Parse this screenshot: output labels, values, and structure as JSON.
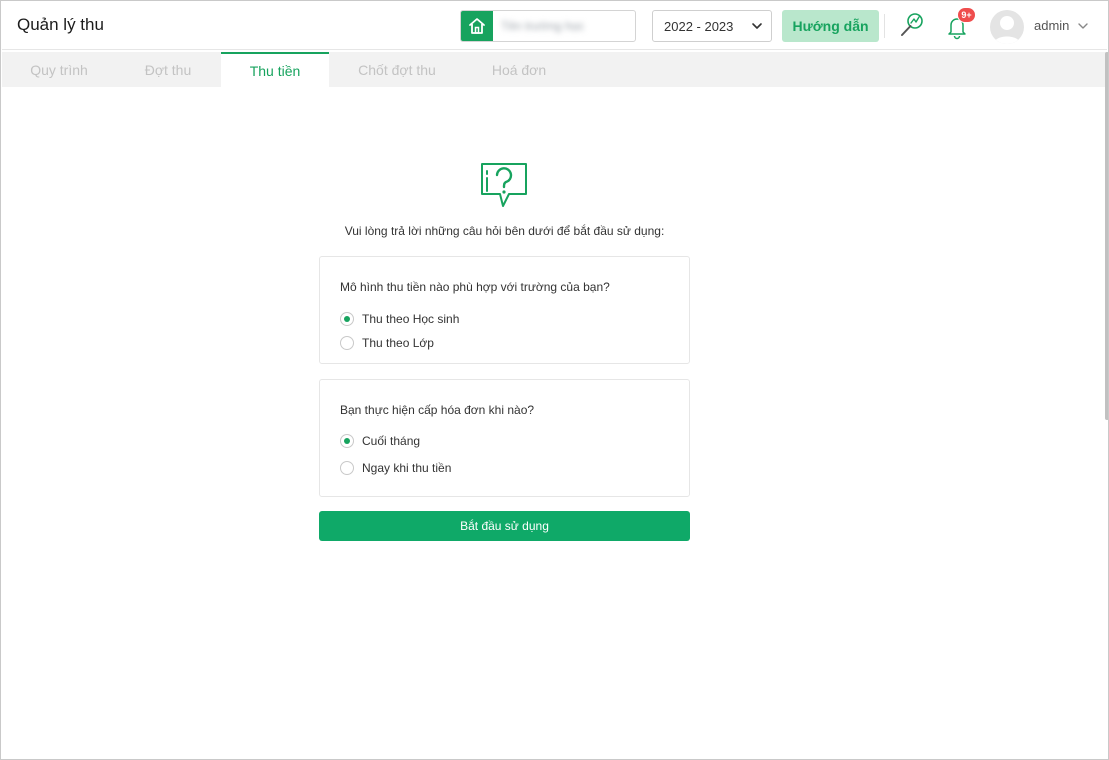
{
  "header": {
    "title": "Quản lý thu",
    "school_name": "Tên trường học",
    "school_year": "2022 - 2023",
    "guide_label": "Hướng dẫn",
    "notification_count": "9+",
    "user_name": "admin"
  },
  "tabs": [
    {
      "label": "Quy trình"
    },
    {
      "label": "Đợt thu"
    },
    {
      "label": "Thu tiền"
    },
    {
      "label": "Chốt đợt thu"
    },
    {
      "label": "Hoá đơn"
    }
  ],
  "active_tab": "Thu tiền",
  "main": {
    "intro": "Vui lòng trả lời những câu hỏi bên dưới để bắt đầu sử dụng:",
    "questions": [
      {
        "question": "Mô hình thu tiền nào phù hợp với trường của bạn?",
        "options": [
          {
            "label": "Thu theo Học sinh",
            "selected": true
          },
          {
            "label": "Thu theo Lớp",
            "selected": false
          }
        ]
      },
      {
        "question": "Bạn thực hiện cấp hóa đơn khi nào?",
        "options": [
          {
            "label": "Cuối tháng",
            "selected": true
          },
          {
            "label": "Ngay khi thu tiền",
            "selected": false
          }
        ]
      }
    ],
    "start_button": "Bắt đầu sử dụng"
  },
  "colors": {
    "brand": "#17a35e",
    "guide_bg": "#b9e7cc",
    "button": "#0fa968",
    "badge": "#ef4d4d"
  },
  "icons": [
    "home-icon",
    "chevron-down-icon",
    "magic-wand-icon",
    "bell-icon",
    "avatar",
    "question-chat-icon"
  ]
}
